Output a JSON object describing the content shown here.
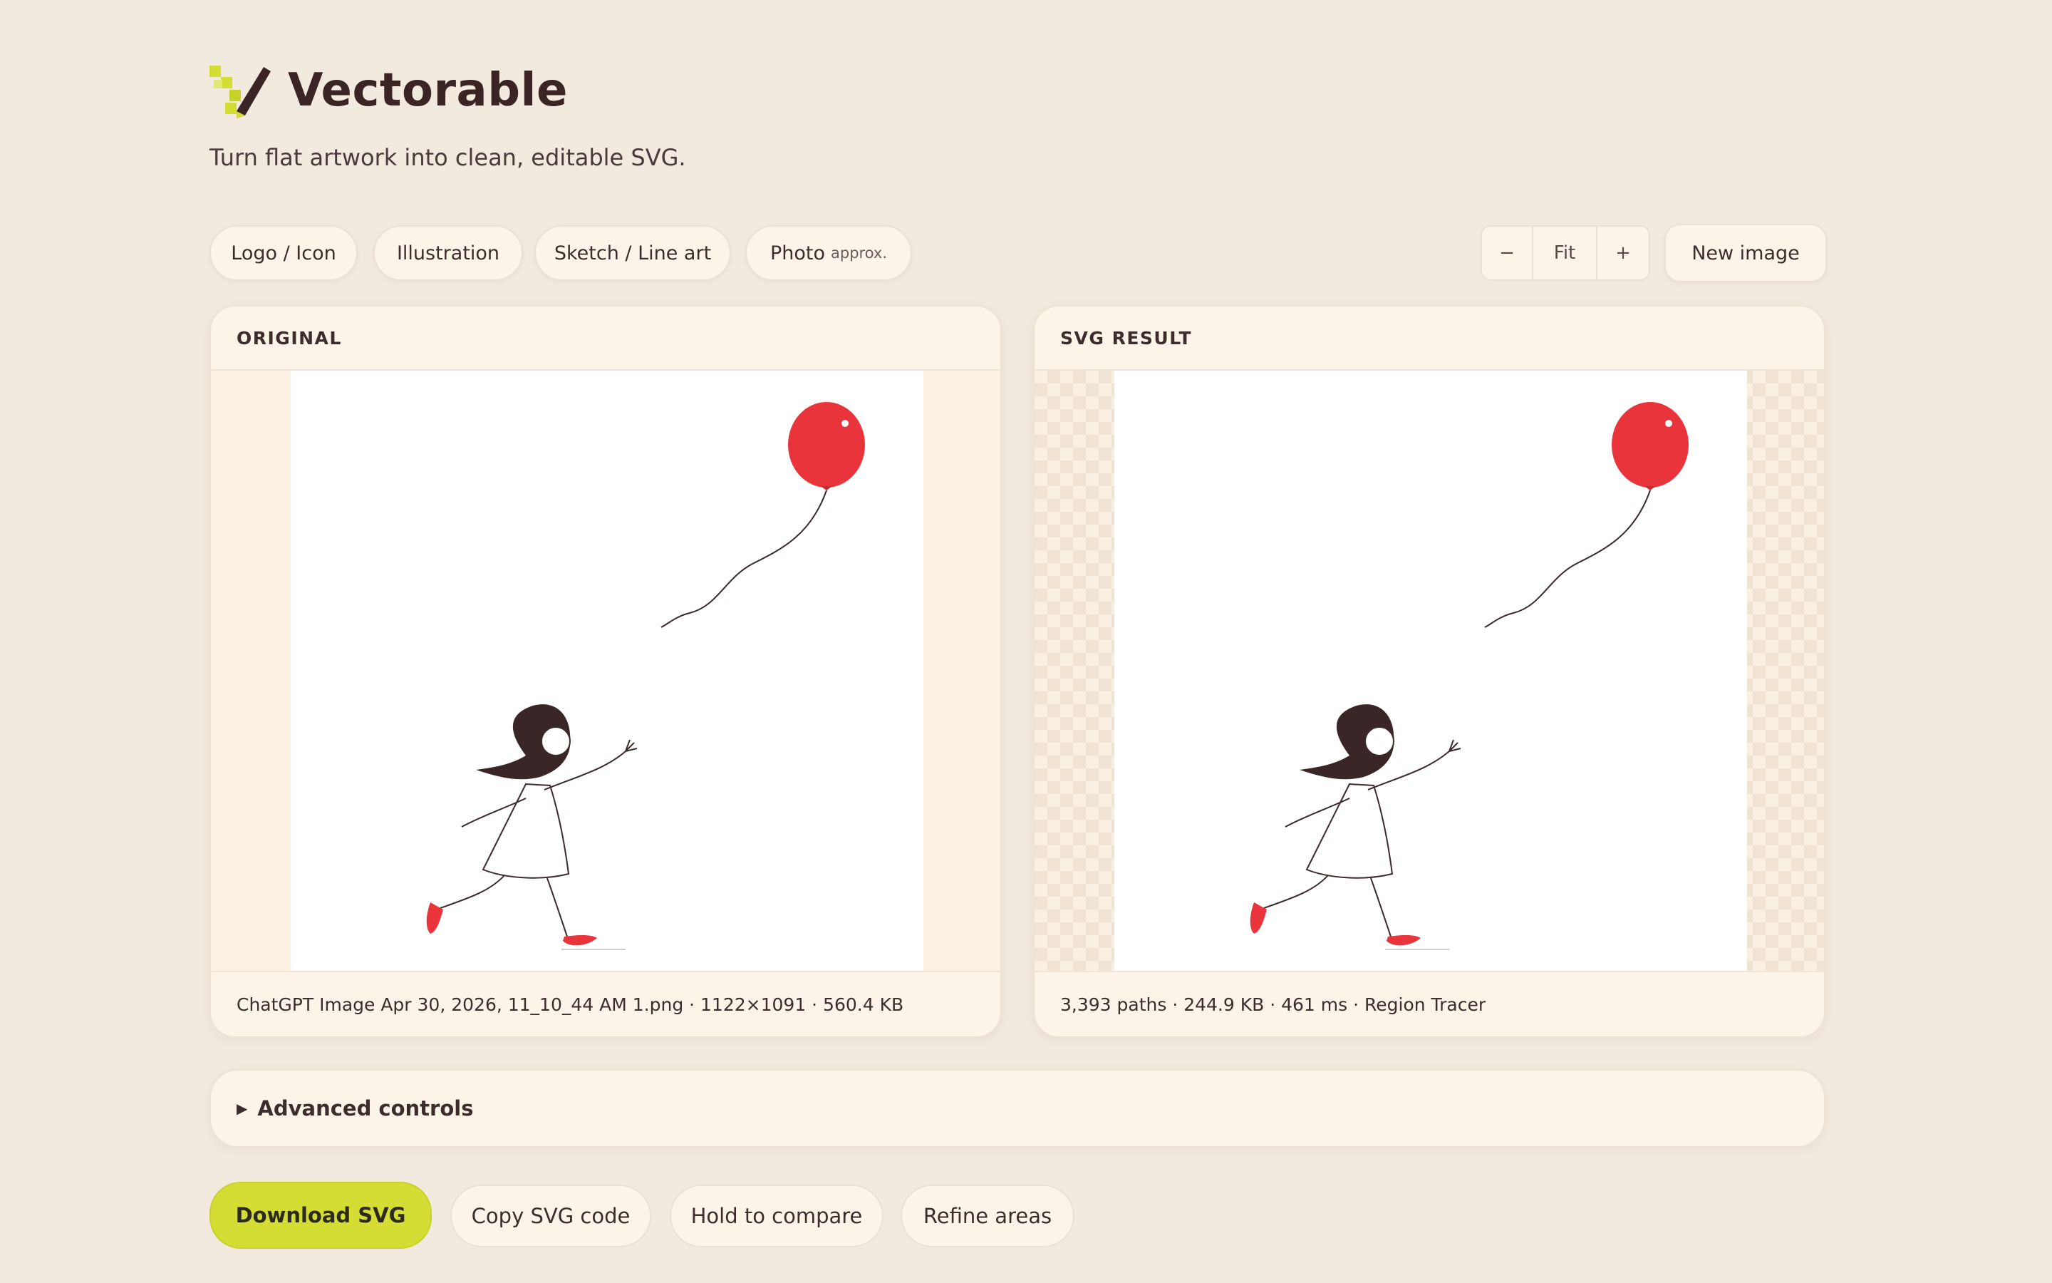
{
  "app": {
    "title": "Vectorable",
    "tagline": "Turn flat artwork into clean, editable SVG."
  },
  "presets": [
    {
      "label": "Logo / Icon"
    },
    {
      "label": "Illustration"
    },
    {
      "label": "Sketch / Line art"
    },
    {
      "label": "Photo",
      "note": "approx."
    }
  ],
  "zoom": {
    "minus": "−",
    "fit": "Fit",
    "plus": "+"
  },
  "new_image_label": "New image",
  "original_panel": {
    "title": "ORIGINAL",
    "footer": "ChatGPT Image Apr 30, 2026, 11_10_44 AM 1.png · 1122×1091 · 560.4 KB"
  },
  "result_panel": {
    "title": "SVG RESULT",
    "footer": "3,393 paths · 244.9 KB · 461 ms · Region Tracer"
  },
  "advanced_controls_label": "Advanced controls",
  "actions": {
    "download": "Download SVG",
    "copy": "Copy SVG code",
    "compare": "Hold to compare",
    "refine": "Refine areas"
  },
  "colors": {
    "accent": "#d4dd34",
    "balloon": "#e8343a",
    "background": "#f2e9df"
  }
}
